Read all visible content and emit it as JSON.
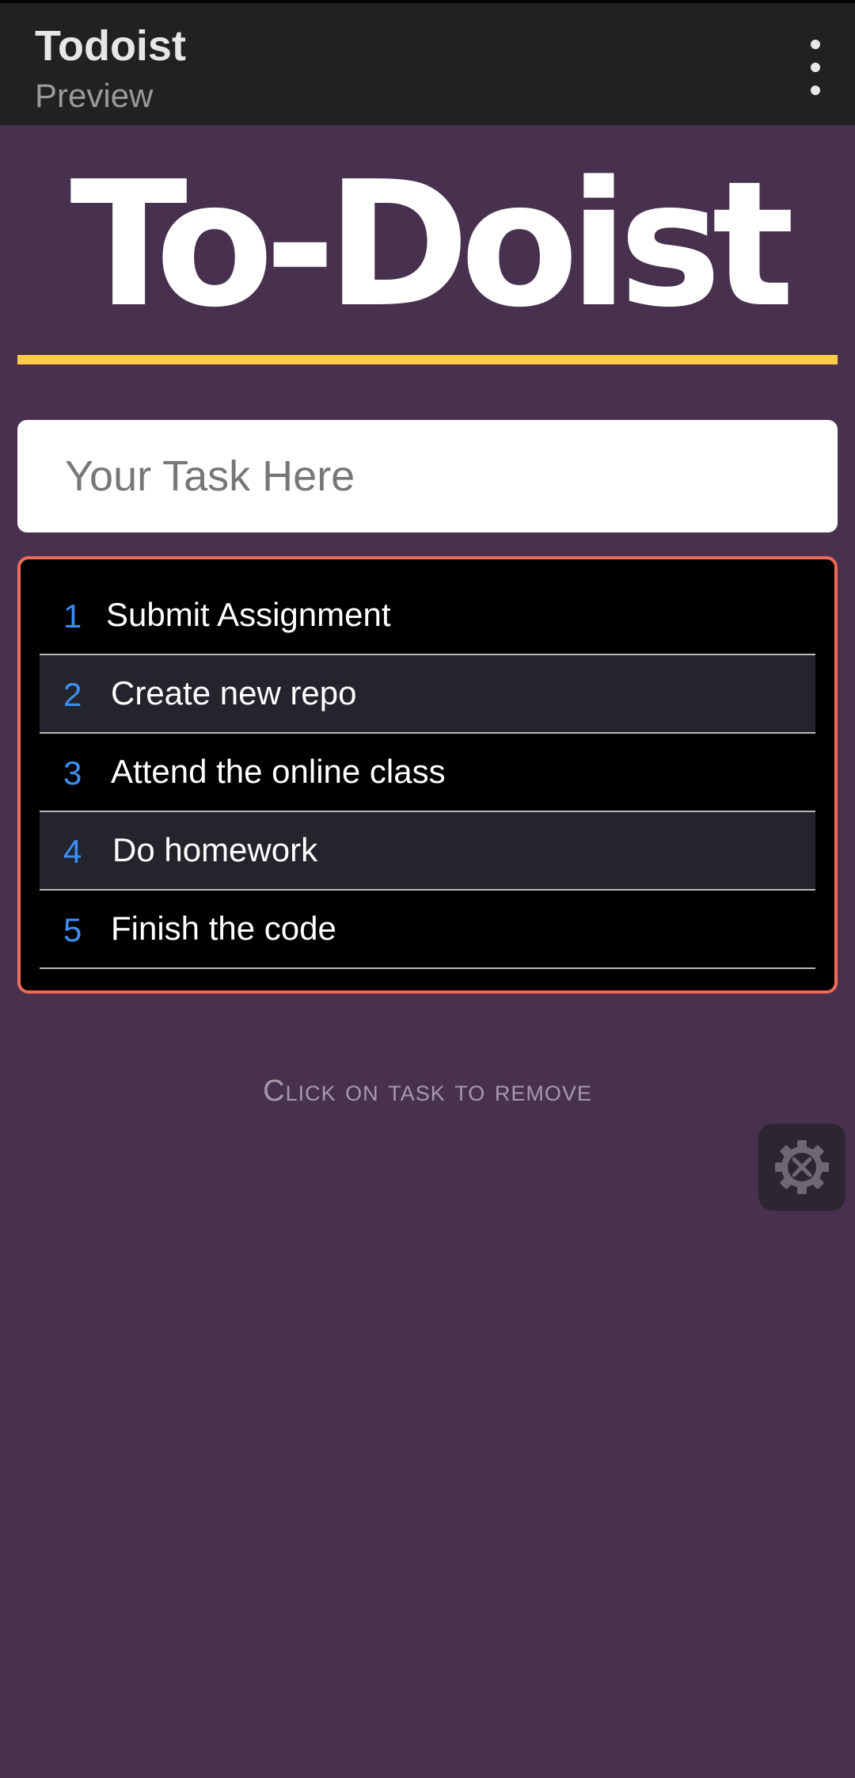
{
  "appbar": {
    "title": "Todoist",
    "subtitle": "Preview",
    "menu_icon": "more-vert-icon"
  },
  "brand": {
    "title": "To-Doist",
    "accent_color": "#ffcd45"
  },
  "input": {
    "placeholder": "Your Task Here",
    "value": ""
  },
  "tasks": [
    {
      "num": "1",
      "text": "Submit Assignment"
    },
    {
      "num": "2",
      "text": "Create new repo"
    },
    {
      "num": "3",
      "text": "Attend the online class"
    },
    {
      "num": "4",
      "text": "Do homework"
    },
    {
      "num": "5",
      "text": "Finish the code"
    }
  ],
  "hint": "Click on task to remove",
  "tools_button": {
    "icon": "settings-tools-icon"
  },
  "colors": {
    "background": "#48314f",
    "panel_border": "#f06a55",
    "task_number": "#3d8ef0"
  }
}
